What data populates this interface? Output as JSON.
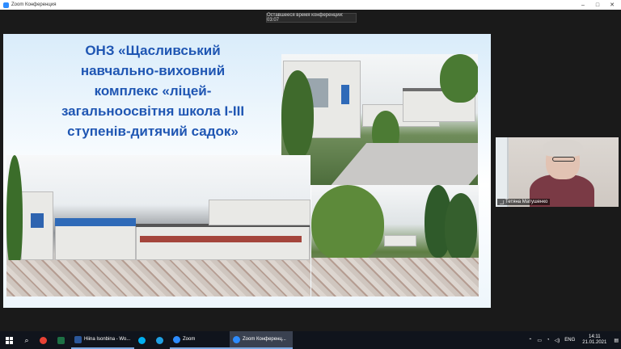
{
  "window": {
    "title": "Zoom Конференция",
    "controls": [
      "–",
      "□",
      "✕"
    ]
  },
  "meeting": {
    "remaining_time_label": "Оставшееся время конференции: 03:07"
  },
  "slide": {
    "title_lines": [
      "ОНЗ «Щасливський",
      "навчально-виховний",
      "комплекс «ліцей-",
      "загальноосвітня школа I-III",
      "ступенів-дитячий садок»"
    ]
  },
  "participant": {
    "name": "Тетяна Матушенко"
  },
  "taskbar": {
    "apps": [
      {
        "label": "",
        "icon": "search-icon"
      },
      {
        "label": "",
        "icon": "chrome-icon",
        "color": "#e94235"
      },
      {
        "label": "",
        "icon": "excel-icon",
        "color": "#1d7044"
      },
      {
        "label": "Hiina Isonbina - Wo...",
        "icon": "word-icon",
        "color": "#2b579a"
      },
      {
        "label": "",
        "icon": "skype-icon",
        "color": "#00aff0"
      },
      {
        "label": "",
        "icon": "edge-icon",
        "color": "#1fa0e3"
      },
      {
        "label": "Zoom",
        "icon": "zoom-icon",
        "color": "#2d8cff"
      },
      {
        "label": "Zoom Конференц...",
        "icon": "zoom-icon",
        "color": "#2d8cff"
      }
    ],
    "tray": {
      "language": "ENG",
      "time": "14:11",
      "date": "21.01.2021"
    }
  },
  "colors": {
    "accent": "#2d8cff",
    "title_text": "#1f56b3"
  }
}
